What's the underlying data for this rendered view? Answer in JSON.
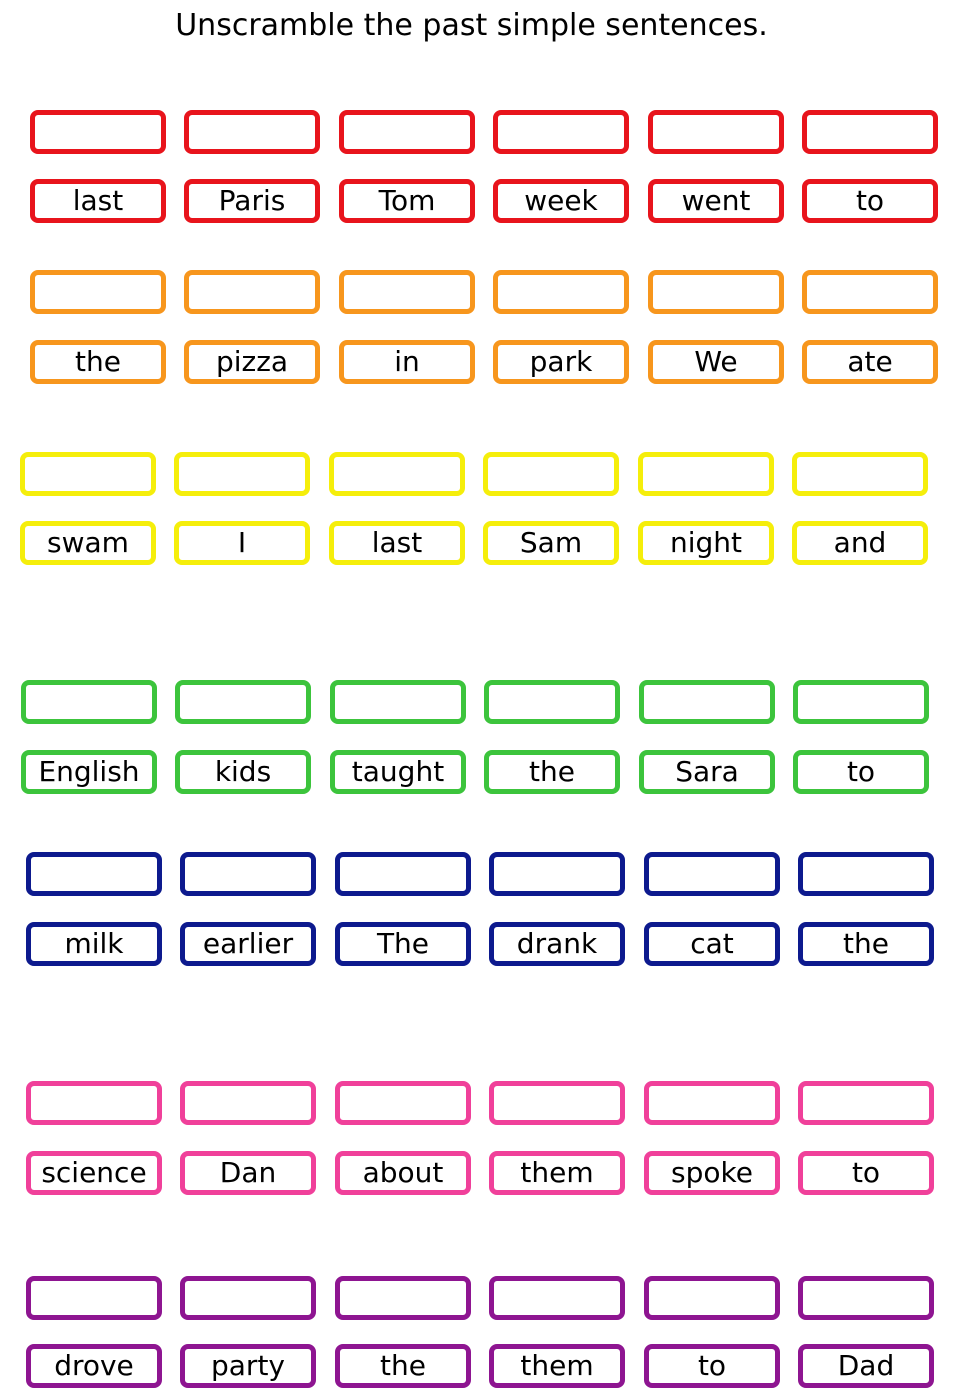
{
  "title": "Unscramble the past simple sentences.",
  "sentences": [
    {
      "color": "#e8141c",
      "words": [
        "last",
        "Paris",
        "Tom",
        "week",
        "went",
        "to"
      ]
    },
    {
      "color": "#f7961d",
      "words": [
        "the",
        "pizza",
        "in",
        "park",
        "We",
        "ate"
      ]
    },
    {
      "color": "#f5ee0b",
      "words": [
        "swam",
        "I",
        "last",
        "Sam",
        "night",
        "and"
      ]
    },
    {
      "color": "#3cc43c",
      "words": [
        "English",
        "kids",
        "taught",
        "the",
        "Sara",
        "to"
      ]
    },
    {
      "color": "#0d1a8e",
      "words": [
        "milk",
        "earlier",
        "The",
        "drank",
        "cat",
        "the"
      ]
    },
    {
      "color": "#f0409a",
      "words": [
        "science",
        "Dan",
        "about",
        "them",
        "spoke",
        "to"
      ]
    },
    {
      "color": "#8e1591",
      "words": [
        "drove",
        "party",
        "the",
        "them",
        "to",
        "Dad"
      ]
    }
  ]
}
